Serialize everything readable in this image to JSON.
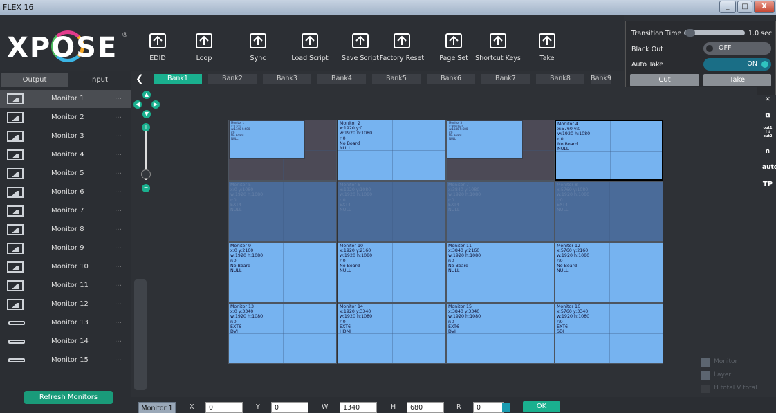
{
  "window": {
    "title": "FLEX 16",
    "controls": [
      "_",
      "□",
      "X"
    ]
  },
  "logo": {
    "text": "XPOSE",
    "reg": "®"
  },
  "toolbar": [
    {
      "label": "EDID",
      "icon": "edid-chip-icon"
    },
    {
      "label": "Loop",
      "icon": "loop-film-icon"
    },
    {
      "label": "Sync",
      "icon": "sync-arrows-icon"
    },
    {
      "label": "Load Script",
      "icon": "load-script-icon"
    },
    {
      "label": "Save Script",
      "icon": "save-script-icon"
    },
    {
      "label": "Factory Reset",
      "icon": "factory-reset-icon"
    },
    {
      "label": "Page Set",
      "icon": "page-set-icon"
    },
    {
      "label": "Shortcut Keys",
      "icon": "link-chain-icon"
    },
    {
      "label": "Take",
      "icon": "take-tbar-icon"
    }
  ],
  "transition": {
    "time_label": "Transition Time",
    "time_value": "1.0 sec",
    "blackout_label": "Black Out",
    "blackout_state": "OFF",
    "autotake_label": "Auto Take",
    "autotake_state": "ON",
    "cut_label": "Cut",
    "take_label": "Take"
  },
  "tabs": {
    "output": "Output",
    "input": "Input"
  },
  "monitors": [
    {
      "label": "Monitor 1",
      "type": "monitor"
    },
    {
      "label": "Monitor 2",
      "type": "monitor"
    },
    {
      "label": "Monitor 3",
      "type": "monitor"
    },
    {
      "label": "Monitor 4",
      "type": "monitor"
    },
    {
      "label": "Monitor 5",
      "type": "monitor"
    },
    {
      "label": "Monitor 6",
      "type": "monitor"
    },
    {
      "label": "Monitor 7",
      "type": "monitor"
    },
    {
      "label": "Monitor 8",
      "type": "monitor"
    },
    {
      "label": "Monitor 9",
      "type": "monitor"
    },
    {
      "label": "Monitor 10",
      "type": "monitor"
    },
    {
      "label": "Monitor 11",
      "type": "monitor"
    },
    {
      "label": "Monitor 12",
      "type": "monitor"
    },
    {
      "label": "Monitor 13",
      "type": "card"
    },
    {
      "label": "Monitor 14",
      "type": "card"
    },
    {
      "label": "Monitor 15",
      "type": "card"
    }
  ],
  "monitor_more": "...",
  "refresh_label": "Refresh Monitors",
  "banks": [
    "Bank1",
    "Bank2",
    "Bank3",
    "Bank4",
    "Bank5",
    "Bank6",
    "Bank7",
    "Bank8",
    "Bank9"
  ],
  "active_bank": "Bank1",
  "cells": [
    {
      "state": "grey",
      "info": "",
      "sub": "Monitor 1\nx:0 y:0\nw:1340 h:680\nr:0\nNo Board\nNULL"
    },
    {
      "state": "blue",
      "info": "Monitor 2\nx:1920 y:0\nw:1920 h:1080\nr:0\nNo Board\nNULL"
    },
    {
      "state": "grey",
      "info": "",
      "sub": "Monitor 3\nx:3840 y:0\nw:1340 h:680\nr:0\nNo Board\nNULL"
    },
    {
      "state": "blue-sel",
      "info": "Monitor 4\nx:5760 y:0\nw:1920 h:1080\nr:0\nNo Board\nNULL"
    },
    {
      "state": "dim",
      "info": "Monitor 5\nx:0 y:1080\nw:1920 h:1080\nr:0\nEXT4\nNULL"
    },
    {
      "state": "dim",
      "info": "Monitor 6\nx:1920 y:1080\nw:1920 h:1080\nr:0\nEXT4\nNULL"
    },
    {
      "state": "dim",
      "info": "Monitor 7\nx:3840 y:1080\nw:1920 h:1080\nr:0\nEXT4\nNULL"
    },
    {
      "state": "dim",
      "info": "Monitor 8\nx:5760 y:1080\nw:1920 h:1080\nr:0\nEXT4\nNULL"
    },
    {
      "state": "blue",
      "info": "Monitor 9\nx:0 y:2160\nw:1920 h:1080\nr:0\nNo Board\nNULL"
    },
    {
      "state": "blue",
      "info": "Monitor 10\nx:1920 y:2160\nw:1920 h:1080\nr:0\nNo Board\nNULL"
    },
    {
      "state": "blue",
      "info": "Monitor 11\nx:3840 y:2160\nw:1920 h:1080\nr:0\nNo Board\nNULL"
    },
    {
      "state": "blue",
      "info": "Monitor 12\nx:5760 y:2160\nw:1920 h:1080\nr:0\nNo Board\nNULL"
    },
    {
      "state": "blue",
      "info": "Monitor 13\nx:0 y:3340\nw:1920 h:1080\nr:0\nEXT6\nDVI"
    },
    {
      "state": "blue",
      "info": "Monitor 14\nx:1920 y:3340\nw:1920 h:1080\nr:0\nEXT6\nHDMI"
    },
    {
      "state": "blue",
      "info": "Monitor 15\nx:3840 y:3340\nw:1920 h:1080\nr:0\nEXT6\nDVI"
    },
    {
      "state": "blue",
      "info": "Monitor 16\nx:5760 y:3340\nw:1920 h:1080\nr:0\nEXT6\nSDI"
    }
  ],
  "right_icons": [
    "close-square-icon",
    "copy-icon",
    "out-swap-icon",
    "audio-icon",
    "auto-icon",
    "tp-icon"
  ],
  "right_labels": {
    "out": "out1\n↑↓\nout2",
    "auto": "auto",
    "tp": "TP"
  },
  "legend": [
    {
      "label": "Monitor",
      "color": "#5c6570"
    },
    {
      "label": "Layer",
      "color": "#5c6570"
    },
    {
      "label": "H total V total",
      "color": "#3a3d42"
    }
  ],
  "bottom": {
    "monitor": "Monitor 1",
    "x_label": "X",
    "x": "0",
    "y_label": "Y",
    "y": "0",
    "w_label": "W",
    "w": "1340",
    "h_label": "H",
    "h": "680",
    "r_label": "R",
    "r": "0",
    "ok": "OK"
  },
  "colors": {
    "accent": "#1ab08f",
    "cell_blue": "#76b3f0",
    "cell_dim": "#4a6b99"
  }
}
